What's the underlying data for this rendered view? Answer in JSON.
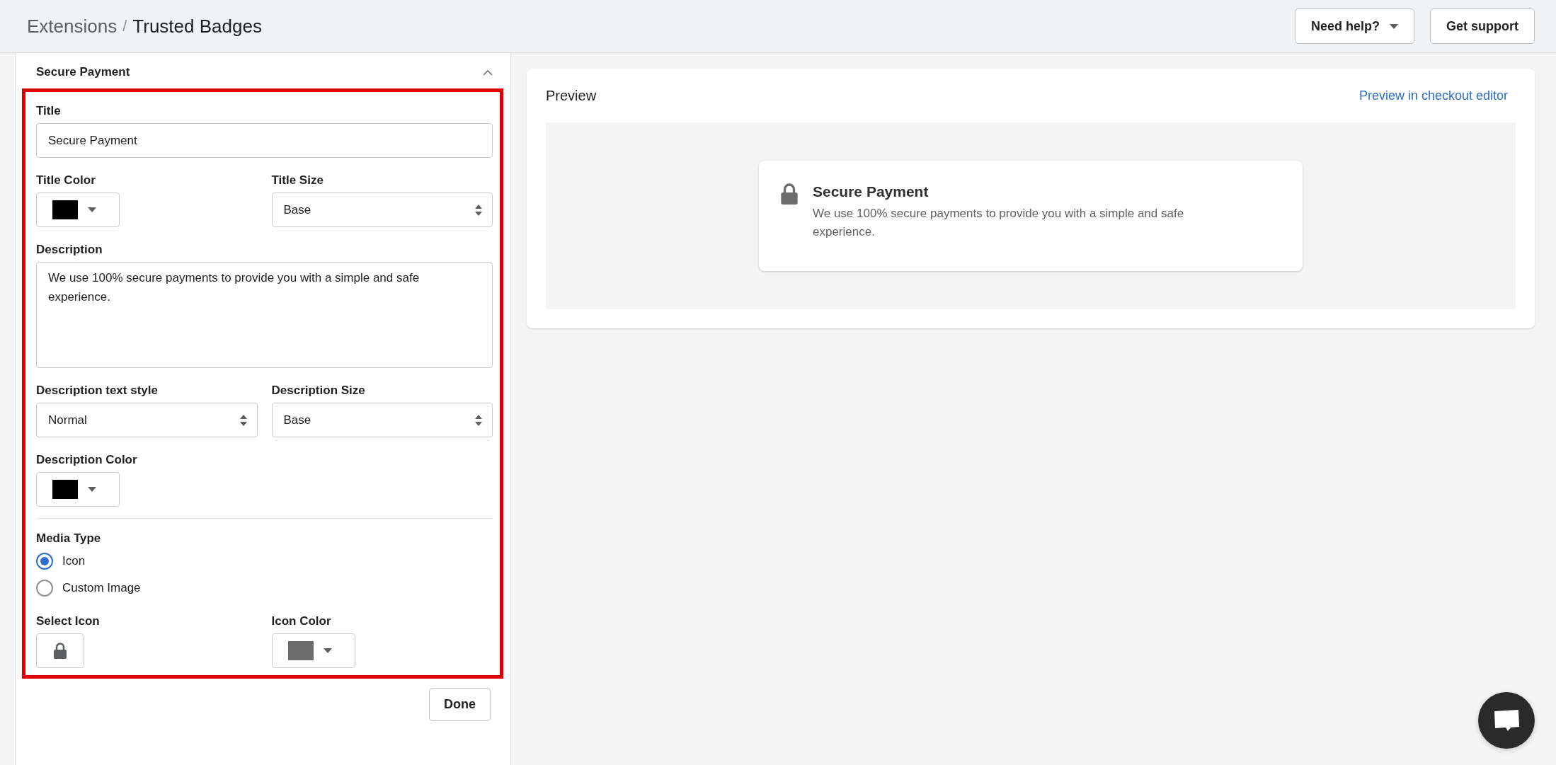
{
  "breadcrumb": {
    "parent": "Extensions",
    "separator": "/",
    "current": "Trusted Badges"
  },
  "header_buttons": [
    {
      "label": "Need help?",
      "kind": "dropdown"
    },
    {
      "label": "Get support",
      "kind": "plain"
    }
  ],
  "editor": {
    "title": "Secure Payment",
    "expanded": true,
    "highlighted": true,
    "sections": [
      {
        "rows": [
          [
            {
              "kind": "text",
              "label": "Title",
              "value": "Secure Payment"
            }
          ],
          [
            {
              "kind": "color",
              "label": "Title Color",
              "color": "#000000"
            },
            {
              "kind": "select",
              "label": "Title Size",
              "value": "Base"
            }
          ],
          [
            {
              "kind": "textarea",
              "label": "Description",
              "value": "We use 100% secure payments to provide you with a simple and safe experience."
            }
          ],
          [
            {
              "kind": "select",
              "label": "Description text style",
              "value": "Normal"
            },
            {
              "kind": "select",
              "label": "Description Size",
              "value": "Base"
            }
          ],
          [
            {
              "kind": "color",
              "label": "Description Color",
              "color": "#000000"
            }
          ]
        ]
      },
      {
        "rows": [
          [
            {
              "kind": "radio",
              "label": "Media Type",
              "options": [
                {
                  "label": "Icon",
                  "selected": true
                },
                {
                  "label": "Custom Image",
                  "selected": false
                }
              ]
            }
          ],
          [
            {
              "kind": "icon",
              "label": "Select Icon"
            },
            {
              "kind": "color",
              "label": "Icon Color",
              "color": "#6d6d6d"
            }
          ]
        ]
      }
    ],
    "done": "Done"
  },
  "preview": {
    "title": "Preview",
    "link": "Preview in checkout editor",
    "badge": {
      "title": "Secure Payment",
      "description": "We use 100% secure payments to provide you with a simple and safe experience."
    }
  }
}
